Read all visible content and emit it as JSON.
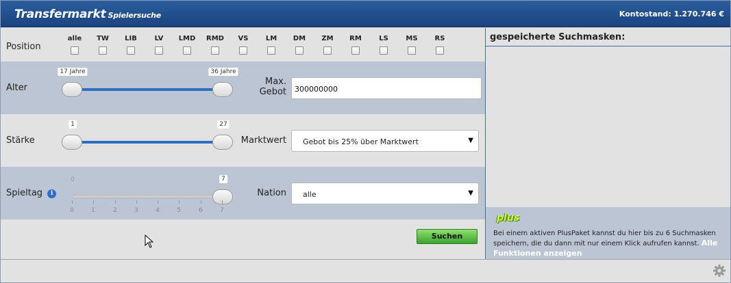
{
  "header": {
    "title": "Transfermarkt",
    "subtitle": "Spielersuche",
    "balance": "Kontostand: 1.270.746 €"
  },
  "position": {
    "label": "Position",
    "options": [
      "alle",
      "TW",
      "LIB",
      "LV",
      "LMD",
      "RMD",
      "VS",
      "LM",
      "DM",
      "ZM",
      "RM",
      "LS",
      "MS",
      "RS"
    ]
  },
  "alter": {
    "label": "Alter",
    "min": 17,
    "max": 36,
    "range_min": 17,
    "range_max": 36,
    "min_label": "17 Jahre",
    "max_label": "36 Jahre"
  },
  "staerke": {
    "label": "Stärke",
    "min": 1,
    "max": 27,
    "range_min": 1,
    "range_max": 27,
    "min_label": "1",
    "max_label": "27"
  },
  "spieltag": {
    "label": "Spieltag",
    "info_icon": "i",
    "min": 0,
    "max": 7,
    "current": 7,
    "min_label": "0",
    "max_label": "7",
    "ticks": [
      "0",
      "1",
      "2",
      "3",
      "4",
      "5",
      "6",
      "7"
    ]
  },
  "gebot": {
    "label_line1": "Max.",
    "label_line2": "Gebot",
    "value": "300000000"
  },
  "marktwert": {
    "label": "Marktwert",
    "selected": "Gebot bis 25% über Marktwert"
  },
  "nation": {
    "label": "Nation",
    "selected": "alle"
  },
  "search_button": "Suchen",
  "saved": {
    "title": "gespeicherte Suchmasken:",
    "plus_badge": "plus",
    "info_text": "Bei einem aktiven PlusPaket kannst du hier bis zu 6 Suchmasken speichern, die du dann mit nur einem Klick aufrufen kannst.",
    "link_text": "Alle Funktionen anzeigen"
  },
  "colors": {
    "header": "#1f4c8a",
    "band": "#bcc5d4",
    "panel": "#e2e2e2",
    "slider_fill": "#2e6fc1",
    "search_button": "#5cc048"
  }
}
